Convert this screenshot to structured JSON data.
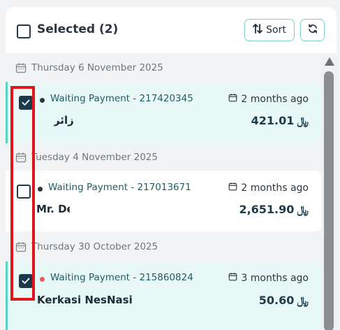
{
  "header": {
    "title": "Selected (2)",
    "sort_label": "Sort"
  },
  "groups": [
    {
      "date": "Thursday 6 November 2025",
      "order": {
        "status": "Waiting Payment - 217420345",
        "time_ago": "2 months ago",
        "customer": "زائر",
        "amount": "421.01",
        "checked": true,
        "status_dot_color": "#2b3640"
      }
    },
    {
      "date": "Tuesday 4 November 2025",
      "order": {
        "status": "Waiting Payment - 217013671",
        "time_ago": "2 months ago",
        "customer": "Mr. De",
        "amount": "2,651.90",
        "checked": false,
        "status_dot_color": "#2b3640"
      }
    },
    {
      "date": "Thursday 30 October 2025",
      "order": {
        "status": "Waiting Payment - 215860824",
        "time_ago": "3 months ago",
        "customer": "Kerkasi NesNasi",
        "amount": "50.60",
        "checked": true,
        "status_dot_color": "#ea5a5a"
      }
    }
  ],
  "currency_symbol": "﷼",
  "colors": {
    "accent": "#5cd3c1",
    "selected_bg": "#e8f8f6",
    "checkbox_checked": "#1b3a4b",
    "highlight": "#e0161b"
  }
}
